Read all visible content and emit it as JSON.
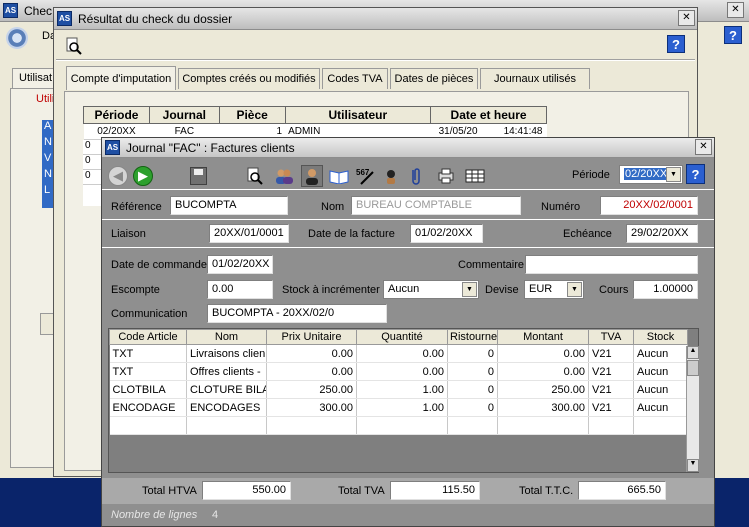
{
  "bg_app": {
    "title": "Chec",
    "menu_label": "Da",
    "tab_label": "Utilisat",
    "group_label": "Utili",
    "list_items": [
      "A",
      "N",
      "V",
      "N",
      "L"
    ]
  },
  "result_window": {
    "title": "Résultat du check du dossier",
    "tabs": [
      "Compte d'imputation",
      "Comptes créés ou modifiés",
      "Codes TVA",
      "Dates de pièces",
      "Journaux utilisés"
    ],
    "table": {
      "headers": [
        "Période",
        "Journal",
        "Pièce",
        "Utilisateur",
        "Date et heure"
      ],
      "row": {
        "periode": "02/20XX",
        "journal": "FAC",
        "piece": "1",
        "utilisateur": "ADMIN",
        "date": "31/05/20",
        "heure": "14:41:48"
      },
      "partial_first_col": [
        "0",
        "0",
        "0"
      ]
    },
    "help": "?"
  },
  "journal_window": {
    "title": "Journal \"FAC\" : Factures clients",
    "periode_label": "Période",
    "periode_value": "02/20XX",
    "help": "?",
    "reference_label": "Référence",
    "reference_value": "BUCOMPTA",
    "nom_label": "Nom",
    "nom_value": "BUREAU COMPTABLE",
    "numero_label": "Numéro",
    "numero_value": "20XX/02/0001",
    "liaison_label": "Liaison",
    "liaison_value": "20XX/01/0001",
    "date_facture_label": "Date de la facture",
    "date_facture_value": "01/02/20XX",
    "echeance_label": "Echéance",
    "echeance_value": "29/02/20XX",
    "date_commande_label": "Date de commande",
    "date_commande_value": "01/02/20XX",
    "commentaire_label": "Commentaire",
    "commentaire_value": "",
    "escompte_label": "Escompte",
    "escompte_value": "0.00",
    "stock_label": "Stock à incrémenter",
    "stock_value": "Aucun",
    "devise_label": "Devise",
    "devise_value": "EUR",
    "cours_label": "Cours",
    "cours_value": "1.00000",
    "communication_label": "Communication",
    "communication_value": "BUCOMPTA - 20XX/02/0",
    "grid": {
      "headers": [
        "Code Article",
        "Nom",
        "Prix Unitaire",
        "Quantité",
        "Ristourne",
        "Montant",
        "TVA",
        "Stock"
      ],
      "rows": [
        [
          "TXT",
          "Livraisons clien",
          "0.00",
          "0.00",
          "0",
          "0.00",
          "V21",
          "Aucun"
        ],
        [
          "TXT",
          "Offres clients -",
          "0.00",
          "0.00",
          "0",
          "0.00",
          "V21",
          "Aucun"
        ],
        [
          "CLOTBILA",
          "CLOTURE BILA",
          "250.00",
          "1.00",
          "0",
          "250.00",
          "V21",
          "Aucun"
        ],
        [
          "ENCODAGE",
          "ENCODAGES",
          "300.00",
          "1.00",
          "0",
          "300.00",
          "V21",
          "Aucun"
        ]
      ]
    },
    "total_htva_label": "Total HTVA",
    "total_htva_value": "550.00",
    "total_tva_label": "Total TVA",
    "total_tva_value": "115.50",
    "total_ttc_label": "Total T.T.C.",
    "total_ttc_value": "665.50",
    "nombre_lignes_label": "Nombre de lignes",
    "nombre_lignes_value": "4"
  },
  "colors": {
    "desktop": "#0a246a",
    "window_bg": "#ece9d8",
    "journal_bg": "#8f8f8f",
    "accent": "#2b5fd0",
    "red_text": "#c00000"
  }
}
